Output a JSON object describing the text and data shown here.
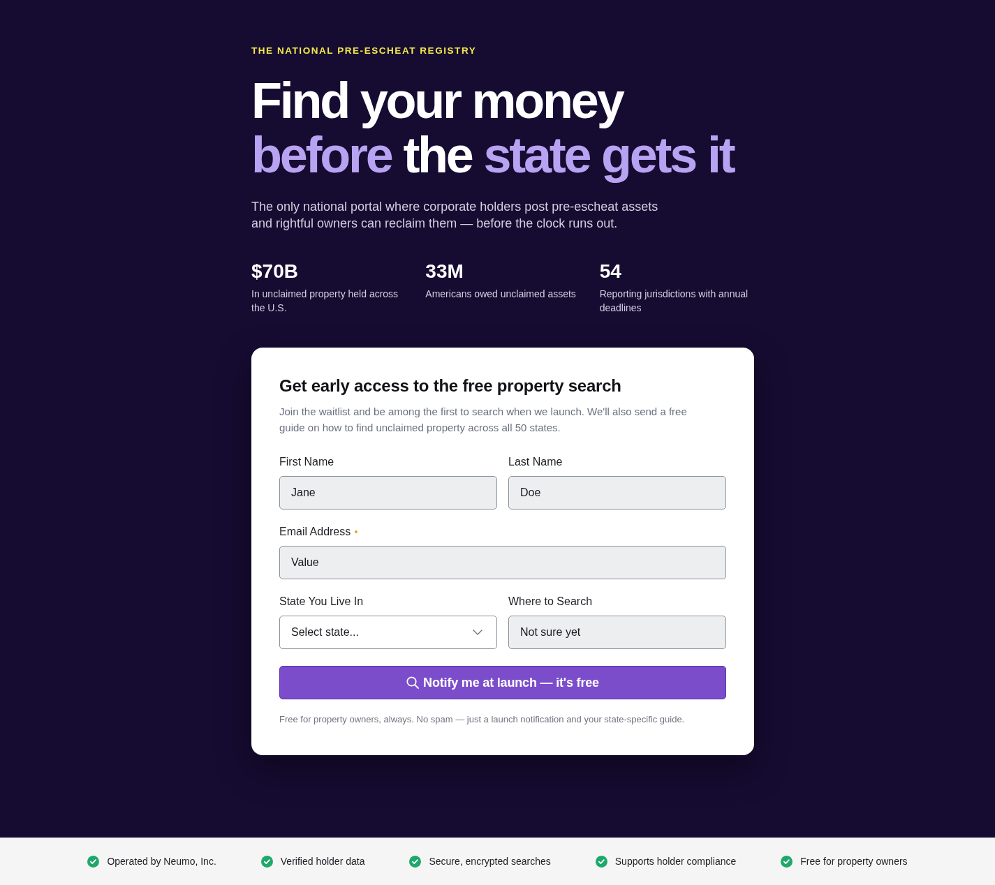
{
  "hero": {
    "eyebrow": "THE NATIONAL PRE-ESCHEAT REGISTRY",
    "headline": [
      [
        {
          "text": "Find your money",
          "accent": false
        }
      ],
      [
        {
          "text": "before",
          "accent": true
        },
        {
          "text": "the",
          "accent": false
        },
        {
          "text": "state gets it",
          "accent": true
        }
      ]
    ],
    "subtitle": "The only national portal where corporate holders post pre-escheat assets and rightful owners can reclaim them — before the clock runs out."
  },
  "stats": [
    {
      "value": "$70B",
      "label": "In unclaimed property held across the U.S."
    },
    {
      "value": "33M",
      "label": "Americans owed unclaimed assets"
    },
    {
      "value": "54",
      "label": "Reporting jurisdictions with annual deadlines"
    }
  ],
  "form": {
    "title": "Get early access to the free property search",
    "description": "Join the waitlist and be among the first to search when we launch. We'll also send a free guide on how to find unclaimed property across all 50 states.",
    "rows": [
      [
        {
          "kind": "text",
          "label": "First Name",
          "value": "Jane",
          "required": false
        },
        {
          "kind": "text",
          "label": "Last Name",
          "value": "Doe",
          "required": false
        }
      ],
      [
        {
          "kind": "text",
          "label": "Email Address",
          "value": "Value",
          "required": true
        }
      ],
      [
        {
          "kind": "select",
          "label": "State You Live In",
          "value": "Select state...",
          "required": false
        },
        {
          "kind": "text",
          "label": "Where to Search",
          "value": "Not sure yet",
          "required": false
        }
      ]
    ],
    "submit": {
      "label": "Notify me at launch — it's free"
    },
    "footnote": "Free for property owners, always. No spam — just a launch notification and your state-specific guide."
  },
  "trust_bar": [
    {
      "label": "Operated by Neumo, Inc."
    },
    {
      "label": "Verified holder data"
    },
    {
      "label": "Secure, encrypted searches"
    },
    {
      "label": "Supports holder compliance"
    },
    {
      "label": "Free for property owners"
    }
  ]
}
